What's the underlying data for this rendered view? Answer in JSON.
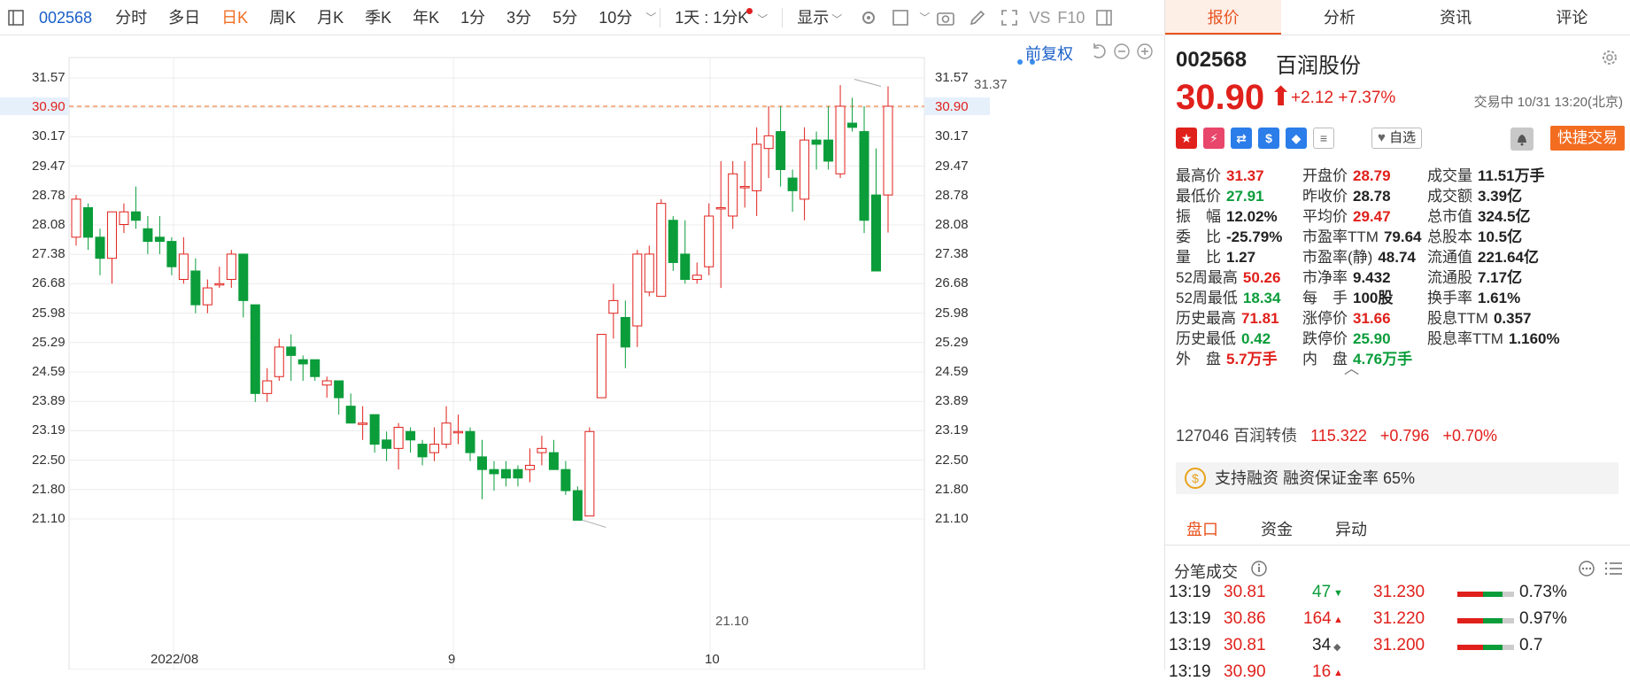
{
  "toolbar": {
    "code": "002568",
    "periods": [
      "分时",
      "多日",
      "日K",
      "周K",
      "月K",
      "季K",
      "年K",
      "1分",
      "3分",
      "5分",
      "10分"
    ],
    "active_period": "日K",
    "interval": "1天 : 1分K",
    "display": "显示",
    "vs": "VS",
    "f10": "F10"
  },
  "chart": {
    "adjust": "前复权",
    "current_price": "30.90",
    "y_labels": [
      "31.57",
      "30.90",
      "30.17",
      "29.47",
      "28.78",
      "28.08",
      "27.38",
      "26.68",
      "25.98",
      "25.29",
      "24.59",
      "23.89",
      "23.19",
      "22.50",
      "21.80",
      "21.10"
    ],
    "x_labels": [
      "2022/08",
      "9",
      "10"
    ],
    "high_label": "31.37",
    "low_label": "21.10",
    "colors": {
      "up": "#e0201b",
      "down": "#0a9d3a",
      "grid": "#ececec",
      "price_line": "#f36d21"
    }
  },
  "chart_data": {
    "type": "candlestick",
    "ohlc": [
      [
        27.8,
        28.7,
        28.8,
        27.6
      ],
      [
        28.5,
        27.8,
        28.6,
        27.5
      ],
      [
        27.8,
        27.3,
        28.0,
        26.9
      ],
      [
        27.3,
        28.4,
        28.4,
        26.7
      ],
      [
        28.1,
        28.4,
        28.6,
        27.9
      ],
      [
        28.4,
        28.2,
        29.0,
        28.0
      ],
      [
        28.0,
        27.7,
        28.3,
        27.4
      ],
      [
        27.8,
        27.7,
        28.3,
        27.4
      ],
      [
        27.7,
        27.1,
        27.8,
        26.9
      ],
      [
        26.8,
        27.4,
        27.8,
        26.7
      ],
      [
        27.0,
        26.2,
        27.3,
        26.0
      ],
      [
        26.2,
        26.6,
        26.8,
        26.0
      ],
      [
        26.7,
        26.7,
        27.1,
        26.6
      ],
      [
        26.8,
        27.4,
        27.5,
        26.6
      ],
      [
        27.4,
        26.3,
        27.4,
        25.9
      ],
      [
        26.2,
        24.1,
        26.2,
        23.9
      ],
      [
        24.1,
        24.4,
        24.7,
        23.9
      ],
      [
        24.5,
        25.2,
        25.4,
        24.4
      ],
      [
        25.2,
        25.0,
        25.5,
        24.4
      ],
      [
        24.9,
        24.8,
        25.0,
        24.4
      ],
      [
        24.9,
        24.5,
        24.9,
        24.4
      ],
      [
        24.3,
        24.4,
        24.5,
        24.0
      ],
      [
        24.4,
        24.0,
        24.4,
        23.6
      ],
      [
        23.8,
        23.4,
        24.1,
        23.4
      ],
      [
        23.4,
        23.4,
        23.8,
        23.0
      ],
      [
        23.6,
        22.9,
        23.6,
        22.7
      ],
      [
        23.0,
        22.8,
        23.2,
        22.5
      ],
      [
        22.8,
        23.3,
        23.4,
        22.3
      ],
      [
        23.2,
        23.0,
        23.3,
        22.7
      ],
      [
        22.9,
        22.6,
        23.0,
        22.4
      ],
      [
        22.7,
        22.9,
        23.3,
        22.5
      ],
      [
        22.9,
        23.4,
        23.8,
        22.8
      ],
      [
        23.2,
        23.2,
        23.6,
        22.9
      ],
      [
        23.2,
        22.7,
        23.3,
        22.5
      ],
      [
        22.6,
        22.3,
        23.0,
        21.6
      ],
      [
        22.3,
        22.2,
        22.5,
        21.8
      ],
      [
        22.3,
        22.1,
        22.5,
        21.9
      ],
      [
        22.3,
        22.1,
        22.4,
        21.9
      ],
      [
        22.3,
        22.4,
        22.8,
        22.0
      ],
      [
        22.7,
        22.8,
        23.1,
        22.4
      ],
      [
        22.7,
        22.3,
        23.0,
        22.3
      ],
      [
        22.3,
        21.8,
        22.5,
        21.7
      ],
      [
        21.8,
        21.1,
        21.9,
        21.1
      ],
      [
        21.2,
        23.2,
        23.3,
        21.2
      ],
      [
        24.0,
        25.5,
        25.5,
        24.0
      ],
      [
        26.0,
        26.3,
        26.7,
        25.4
      ],
      [
        25.9,
        25.2,
        26.3,
        24.7
      ],
      [
        25.7,
        27.4,
        27.5,
        25.2
      ],
      [
        26.5,
        27.4,
        27.6,
        26.4
      ],
      [
        26.4,
        28.6,
        28.7,
        26.4
      ],
      [
        28.2,
        27.2,
        28.3,
        27.0
      ],
      [
        27.4,
        26.8,
        28.2,
        26.7
      ],
      [
        26.8,
        26.9,
        27.2,
        26.7
      ],
      [
        27.1,
        28.3,
        28.6,
        26.9
      ],
      [
        28.5,
        28.5,
        29.6,
        26.6
      ],
      [
        28.3,
        29.3,
        29.6,
        28.0
      ],
      [
        29.0,
        29.0,
        29.6,
        28.5
      ],
      [
        28.9,
        30.0,
        30.4,
        28.3
      ],
      [
        29.9,
        30.2,
        30.9,
        29.2
      ],
      [
        30.3,
        29.4,
        30.9,
        29.0
      ],
      [
        29.2,
        28.9,
        29.4,
        28.4
      ],
      [
        28.7,
        30.1,
        30.4,
        28.2
      ],
      [
        30.1,
        30.0,
        30.3,
        29.4
      ],
      [
        30.1,
        29.6,
        30.9,
        29.4
      ],
      [
        29.3,
        30.9,
        31.4,
        29.2
      ],
      [
        30.5,
        30.4,
        31.1,
        30.3
      ],
      [
        30.3,
        28.2,
        30.9,
        27.9
      ],
      [
        28.8,
        27.0,
        29.9,
        27.0
      ],
      [
        28.8,
        30.9,
        31.37,
        27.91
      ]
    ]
  },
  "panel": {
    "tabs": [
      "报价",
      "分析",
      "资讯",
      "评论"
    ],
    "code": "002568",
    "name": "百润股份",
    "price": "30.90",
    "change": "+2.12",
    "change_pct": "+7.37%",
    "status": "交易中 10/31 13:20(北京)",
    "watch": "自选",
    "trade": "快捷交易",
    "stats": [
      [
        {
          "k": "最高价",
          "v": "31.37",
          "c": "red"
        },
        {
          "k": "开盘价",
          "v": "28.79",
          "c": "red"
        },
        {
          "k": "成交量",
          "v": "11.51万手",
          "c": "dark"
        }
      ],
      [
        {
          "k": "最低价",
          "v": "27.91",
          "c": "green"
        },
        {
          "k": "昨收价",
          "v": "28.78",
          "c": "dark"
        },
        {
          "k": "成交额",
          "v": "3.39亿",
          "c": "dark"
        }
      ],
      [
        {
          "k": "振　幅",
          "v": "12.02%",
          "c": "dark"
        },
        {
          "k": "平均价",
          "v": "29.47",
          "c": "red"
        },
        {
          "k": "总市值",
          "v": "324.5亿",
          "c": "dark"
        }
      ],
      [
        {
          "k": "委　比",
          "v": "-25.79%",
          "c": "dark"
        },
        {
          "k": "市盈率TTM",
          "v": "79.64",
          "c": "dark"
        },
        {
          "k": "总股本",
          "v": "10.5亿",
          "c": "dark"
        }
      ],
      [
        {
          "k": "量　比",
          "v": "1.27",
          "c": "dark"
        },
        {
          "k": "市盈率(静)",
          "v": "48.74",
          "c": "dark"
        },
        {
          "k": "流通值",
          "v": "221.64亿",
          "c": "dark"
        }
      ],
      [
        {
          "k": "52周最高",
          "v": "50.26",
          "c": "red"
        },
        {
          "k": "市净率",
          "v": "9.432",
          "c": "dark"
        },
        {
          "k": "流通股",
          "v": "7.17亿",
          "c": "dark"
        }
      ],
      [
        {
          "k": "52周最低",
          "v": "18.34",
          "c": "green"
        },
        {
          "k": "每　手",
          "v": "100股",
          "c": "dark"
        },
        {
          "k": "换手率",
          "v": "1.61%",
          "c": "dark"
        }
      ],
      [
        {
          "k": "历史最高",
          "v": "71.81",
          "c": "red"
        },
        {
          "k": "涨停价",
          "v": "31.66",
          "c": "red"
        },
        {
          "k": "股息TTM",
          "v": "0.357",
          "c": "dark"
        }
      ],
      [
        {
          "k": "历史最低",
          "v": "0.42",
          "c": "green"
        },
        {
          "k": "跌停价",
          "v": "25.90",
          "c": "green"
        },
        {
          "k": "股息率TTM",
          "v": "1.160%",
          "c": "dark"
        }
      ],
      [
        {
          "k": "外　盘",
          "v": "5.7万手",
          "c": "red"
        },
        {
          "k": "内　盘",
          "v": "4.76万手",
          "c": "green"
        },
        {
          "k": "",
          "v": "",
          "c": "dark"
        }
      ]
    ],
    "bond": {
      "code": "127046",
      "name": "百润转债",
      "price": "115.322",
      "chg": "+0.796",
      "pct": "+0.70%"
    },
    "margin_text": "支持融资 融资保证金率 65%",
    "sub_tabs": [
      "盘口",
      "资金",
      "异动"
    ],
    "ticks_title": "分笔成交",
    "ticks": [
      {
        "time": "13:19",
        "price": "30.81",
        "vol": "47",
        "dir": "down",
        "c": "green"
      },
      {
        "time": "13:19",
        "price": "30.86",
        "vol": "164",
        "dir": "up",
        "c": "red"
      },
      {
        "time": "13:19",
        "price": "30.81",
        "vol": "34",
        "dir": "flat",
        "c": "dark"
      },
      {
        "time": "13:19",
        "price": "30.90",
        "vol": "16",
        "dir": "up",
        "c": "red"
      }
    ],
    "depth": [
      {
        "price": "31.230",
        "pct": "0.73%"
      },
      {
        "price": "31.220",
        "pct": "0.97%"
      },
      {
        "price": "31.200",
        "pct": "0.7"
      }
    ]
  }
}
